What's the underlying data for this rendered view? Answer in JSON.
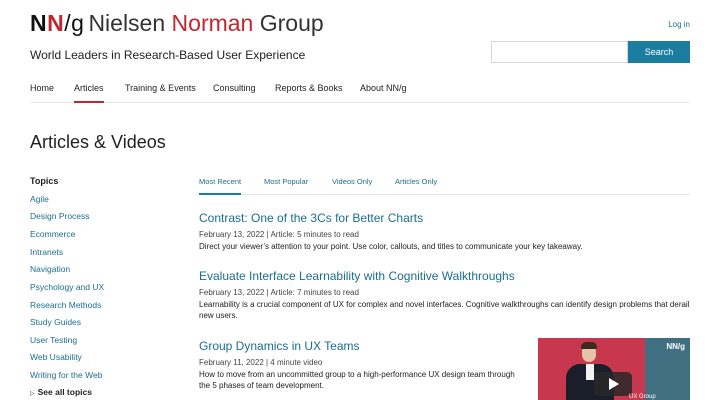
{
  "brand": {
    "mark_n1": "N",
    "mark_n2": "N",
    "mark_slash": "/",
    "mark_g": "g",
    "word_1": "Nielsen",
    "word_2": "Norman",
    "word_3": "Group",
    "tagline": "World Leaders in Research-Based User Experience"
  },
  "header": {
    "login_label": "Log in",
    "search_placeholder": "",
    "search_label": "Search"
  },
  "nav": {
    "items": [
      {
        "label": "Home",
        "active": false
      },
      {
        "label": "Articles",
        "active": true
      },
      {
        "label": "Training & Events",
        "active": false
      },
      {
        "label": "Consulting",
        "active": false
      },
      {
        "label": "Reports & Books",
        "active": false
      },
      {
        "label": "About NN/g",
        "active": false
      }
    ]
  },
  "page": {
    "title": "Articles & Videos"
  },
  "sidebar": {
    "heading": "Topics",
    "topics": [
      "Agile",
      "Design Process",
      "Ecommerce",
      "Intranets",
      "Navigation",
      "Psychology and UX",
      "Research Methods",
      "Study Guides",
      "User Testing",
      "Web Usability",
      "Writing for the Web"
    ],
    "see_all": "See all topics"
  },
  "tabs": [
    {
      "label": "Most Recent",
      "active": true
    },
    {
      "label": "Most Popular",
      "active": false
    },
    {
      "label": "Videos Only",
      "active": false
    },
    {
      "label": "Articles Only",
      "active": false
    }
  ],
  "articles": [
    {
      "title": "Contrast: One of the 3Cs for Better Charts",
      "meta": "February 13, 2022 | Article: 5 minutes to read",
      "desc": "Direct your viewer’s attention to your point. Use color, callouts, and titles to communicate your key takeaway."
    },
    {
      "title": "Evaluate Interface Learnability with Cognitive Walkthroughs",
      "meta": "February 13, 2022 | Article: 7 minutes to read",
      "desc": "Learnability is a crucial component of UX for complex and novel interfaces. Cognitive walkthroughs can identify design problems that derail new users."
    },
    {
      "title": "Group Dynamics in UX Teams",
      "meta": "February 11, 2022 | 4 minute video",
      "desc": "How to move from an uncommitted group to a high-performance UX design team through the 5 phases of team development."
    }
  ],
  "video_thumb": {
    "brand": "NN/g",
    "caption": "UX Group"
  },
  "colors": {
    "accent_red": "#c1272d",
    "link_blue": "#1b6e8f",
    "button_blue": "#1b7ea1"
  }
}
